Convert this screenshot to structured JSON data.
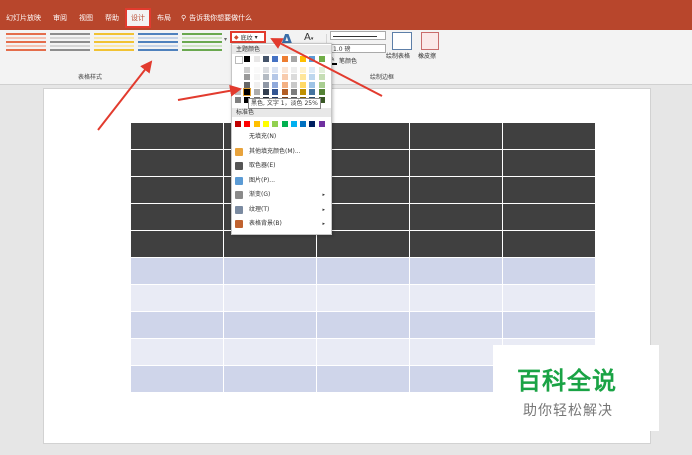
{
  "tabs": [
    "幻灯片放映",
    "审阅",
    "视图",
    "帮助",
    "设计",
    "布局"
  ],
  "active_tab_index": 4,
  "tell_me": "告诉我你想要做什么",
  "groups": {
    "table_styles": "表格样式",
    "draw_borders": "绘制边框"
  },
  "shading": {
    "label": "底纹"
  },
  "pen": {
    "weight": "1.0 磅",
    "color": "笔颜色"
  },
  "draw_table": "绘制表格",
  "eraser": "橡皮擦",
  "dropdown": {
    "theme_colors_title": "主题颜色",
    "standard_colors_title": "标准色",
    "tooltip": "黑色, 文字 1，淡色 25%",
    "theme_top_row": [
      "#ffffff",
      "#000000",
      "#e7e6e6",
      "#44546a",
      "#4472c4",
      "#ed7d31",
      "#a5a5a5",
      "#ffc000",
      "#5b9bd5",
      "#70ad47"
    ],
    "standard_colors": [
      "#c00000",
      "#ff0000",
      "#ffc000",
      "#ffff00",
      "#92d050",
      "#00b050",
      "#00b0f0",
      "#0070c0",
      "#002060",
      "#7030a0"
    ],
    "items": [
      {
        "label": "无填充(N)",
        "icon": "no-fill-icon",
        "submenu": false
      },
      {
        "label": "其他填充颜色(M)...",
        "icon": "color-wheel-icon",
        "submenu": false
      },
      {
        "label": "取色器(E)",
        "icon": "eyedropper-icon",
        "submenu": false
      },
      {
        "label": "图片(P)...",
        "icon": "picture-icon",
        "submenu": false
      },
      {
        "label": "渐变(G)",
        "icon": "gradient-icon",
        "submenu": true
      },
      {
        "label": "纹理(T)",
        "icon": "texture-icon",
        "submenu": true
      },
      {
        "label": "表格背景(B)",
        "icon": "table-background-icon",
        "submenu": true
      }
    ]
  },
  "table": {
    "header_color": "#404040",
    "band_colors": [
      "#cfd5ea",
      "#e9ebf5"
    ],
    "columns": 5,
    "dark_rows": 5,
    "light_rows": 5
  },
  "watermark": {
    "title": "百科全说",
    "subtitle": "助你轻松解决"
  },
  "colors": {
    "title_bar": "#b8462c",
    "highlight": "#e23b2e",
    "watermark_green": "#1aa345"
  }
}
